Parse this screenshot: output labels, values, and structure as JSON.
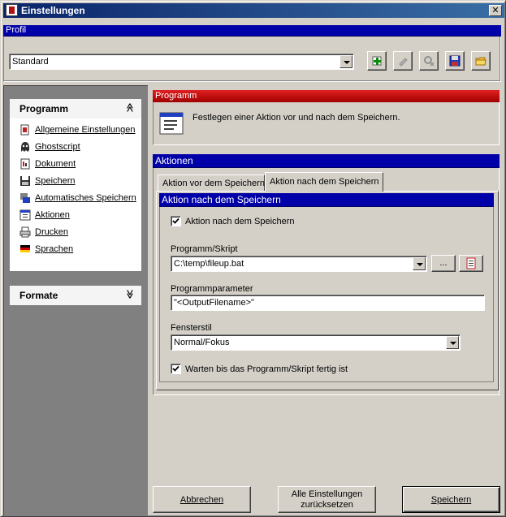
{
  "window": {
    "title": "Einstellungen",
    "close_glyph": "✕"
  },
  "profile": {
    "header": "Profil",
    "selected": "Standard",
    "toolbar": [
      {
        "name": "add-profile-button",
        "icon": "add-icon"
      },
      {
        "name": "rename-profile-button",
        "icon": "rename-icon"
      },
      {
        "name": "delete-profile-button",
        "icon": "delete-icon"
      },
      {
        "name": "save-profile-button",
        "icon": "save-icon"
      },
      {
        "name": "open-profile-button",
        "icon": "folder-icon"
      }
    ]
  },
  "sidebar": {
    "programm_header": "Programm",
    "programm_chevron": "≪",
    "items": [
      {
        "label": "Allgemeine Einstellungen",
        "icon": "settings-icon"
      },
      {
        "label": "Ghostscript",
        "icon": "ghostscript-icon"
      },
      {
        "label": "Dokument",
        "icon": "document-icon"
      },
      {
        "label": "Speichern",
        "icon": "save-icon"
      },
      {
        "label": "Automatisches Speichern",
        "icon": "autosave-icon"
      },
      {
        "label": "Aktionen",
        "icon": "actions-icon"
      },
      {
        "label": "Drucken",
        "icon": "printer-icon"
      },
      {
        "label": "Sprachen",
        "icon": "language-flag-icon"
      }
    ],
    "formate_header": "Formate",
    "formate_chevron": "≫"
  },
  "programm_panel": {
    "header": "Programm",
    "description": "Festlegen einer Aktion vor und nach dem Speichern."
  },
  "aktionen": {
    "header": "Aktionen",
    "tabs": [
      "Aktion vor dem Speichern",
      "Aktion nach dem Speichern"
    ],
    "active_tab": 1,
    "inner_header": "Aktion nach dem Speichern",
    "enable_checkbox": {
      "label": "Aktion nach dem Speichern",
      "checked": true
    },
    "program_label": "Programm/Skript",
    "program_value": "C:\\temp\\fileup.bat",
    "browse_label": "...",
    "params_label": "Programmparameter",
    "params_value": "\"<OutputFilename>\"",
    "window_style_label": "Fensterstil",
    "window_style_value": "Normal/Fokus",
    "wait_checkbox": {
      "label": "Warten bis das Programm/Skript fertig ist",
      "checked": true
    }
  },
  "buttons": {
    "cancel": "Abbrechen",
    "reset_line1": "Alle Einstellungen",
    "reset_line2": "zurücksetzen",
    "save": "Speichern"
  },
  "colors": {
    "header_blue": "#0000a8",
    "header_red": "#c00000",
    "face": "#d4d0c8"
  }
}
